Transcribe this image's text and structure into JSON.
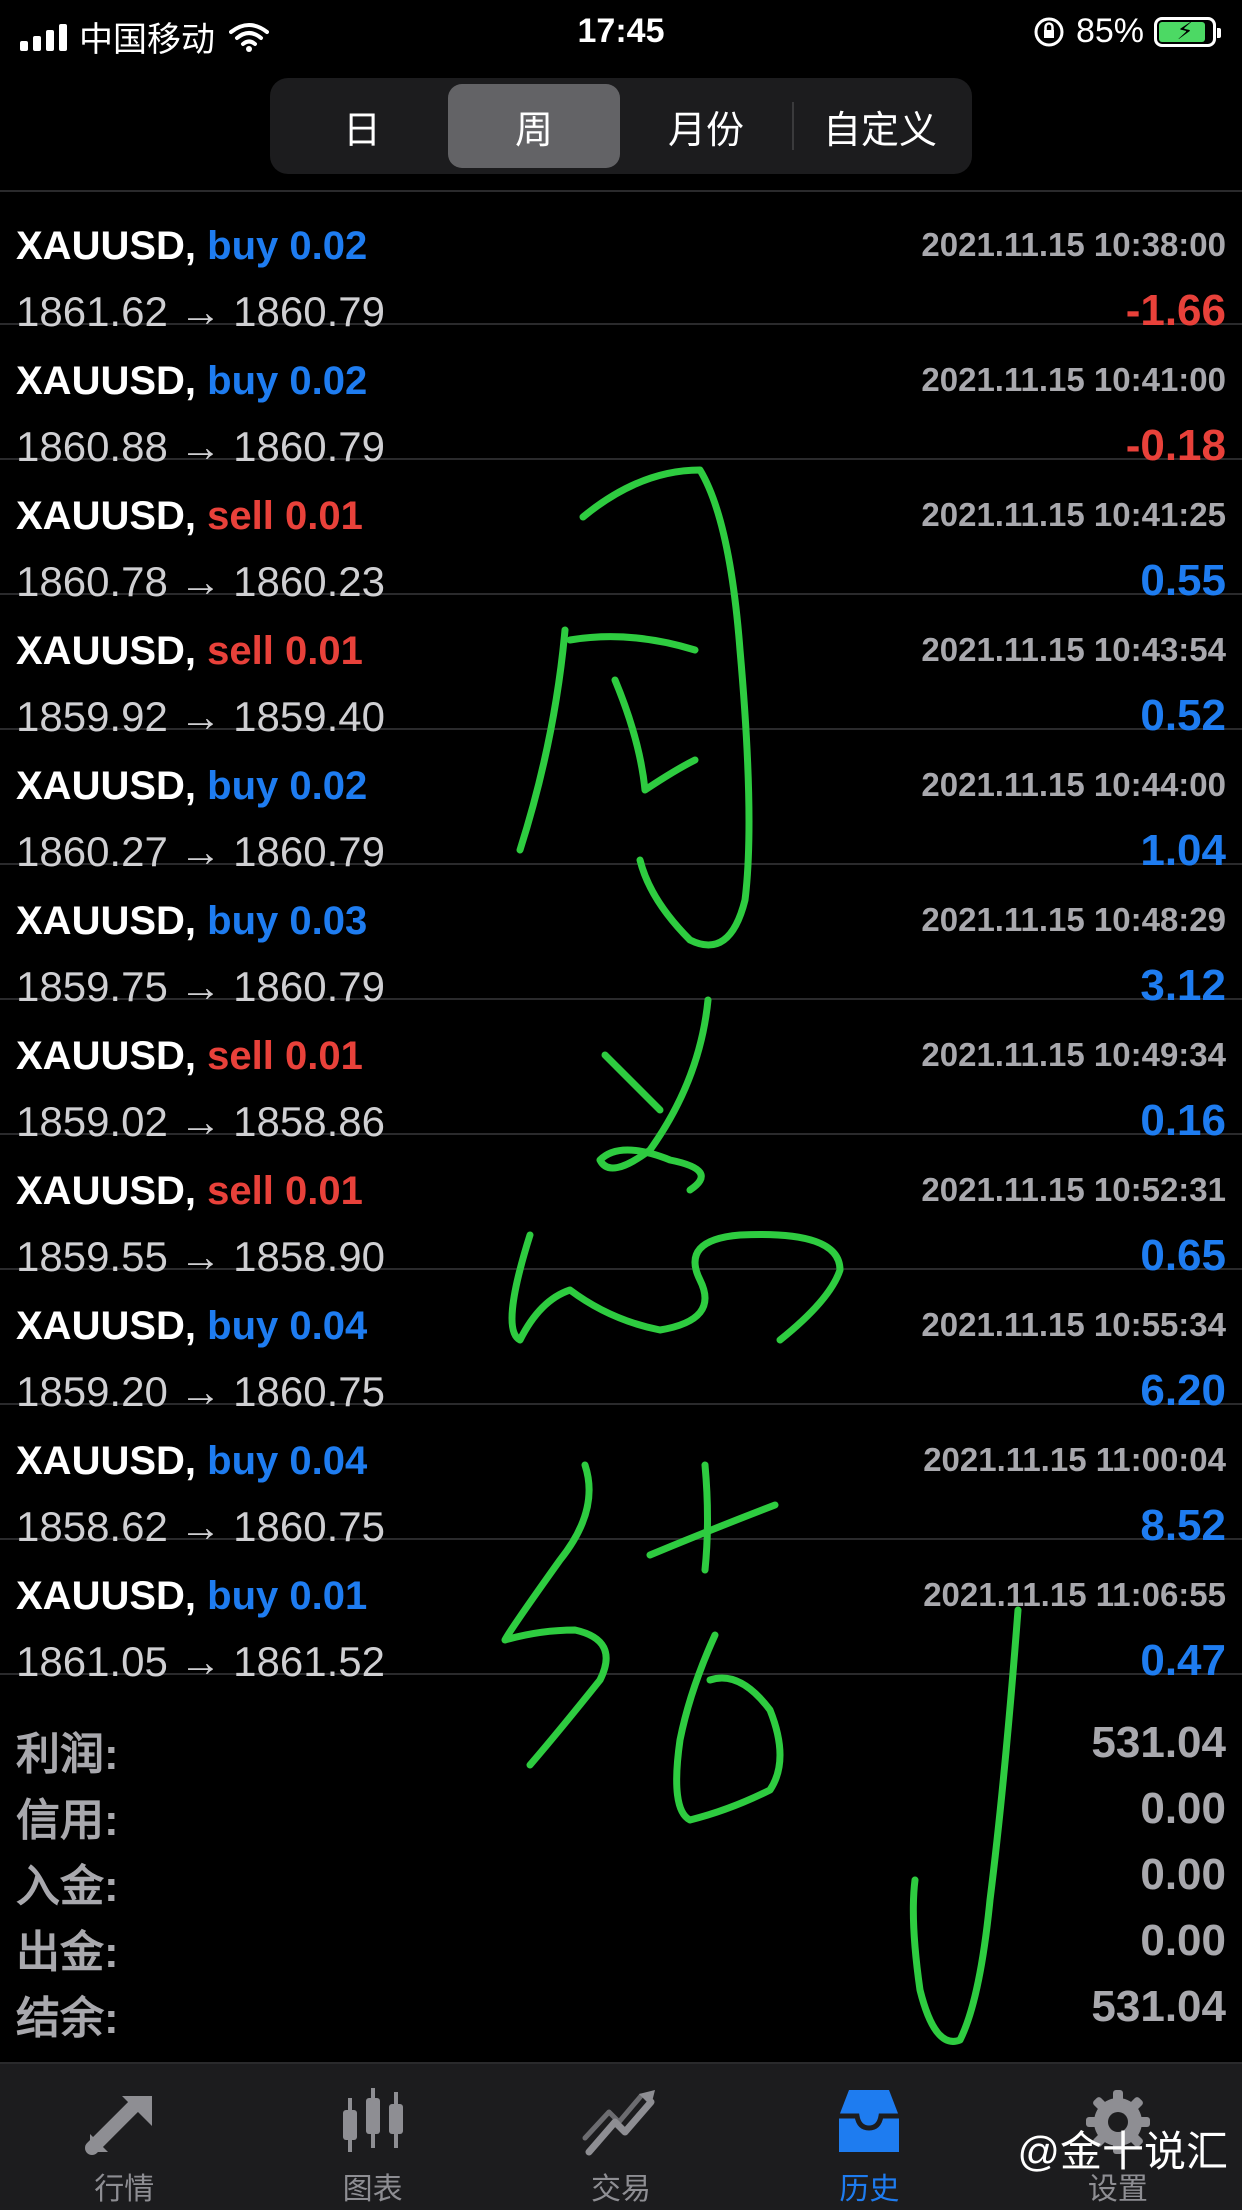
{
  "status_bar": {
    "carrier": "中国移动",
    "time": "17:45",
    "battery": "85%"
  },
  "period_tabs": [
    {
      "label": "日",
      "active": false
    },
    {
      "label": "周",
      "active": true
    },
    {
      "label": "月份",
      "active": false
    },
    {
      "label": "自定义",
      "active": false
    }
  ],
  "trades": [
    {
      "symbol": "XAUUSD,",
      "side": "buy",
      "volume": "buy 0.02",
      "time": "2021.11.15 10:38:00",
      "open": "1861.62",
      "close": "1860.79",
      "profit": "-1.66"
    },
    {
      "symbol": "XAUUSD,",
      "side": "buy",
      "volume": "buy 0.02",
      "time": "2021.11.15 10:41:00",
      "open": "1860.88",
      "close": "1860.79",
      "profit": "-0.18"
    },
    {
      "symbol": "XAUUSD,",
      "side": "sell",
      "volume": "sell 0.01",
      "time": "2021.11.15 10:41:25",
      "open": "1860.78",
      "close": "1860.23",
      "profit": "0.55"
    },
    {
      "symbol": "XAUUSD,",
      "side": "sell",
      "volume": "sell 0.01",
      "time": "2021.11.15 10:43:54",
      "open": "1859.92",
      "close": "1859.40",
      "profit": "0.52"
    },
    {
      "symbol": "XAUUSD,",
      "side": "buy",
      "volume": "buy 0.02",
      "time": "2021.11.15 10:44:00",
      "open": "1860.27",
      "close": "1860.79",
      "profit": "1.04"
    },
    {
      "symbol": "XAUUSD,",
      "side": "buy",
      "volume": "buy 0.03",
      "time": "2021.11.15 10:48:29",
      "open": "1859.75",
      "close": "1860.79",
      "profit": "3.12"
    },
    {
      "symbol": "XAUUSD,",
      "side": "sell",
      "volume": "sell 0.01",
      "time": "2021.11.15 10:49:34",
      "open": "1859.02",
      "close": "1858.86",
      "profit": "0.16"
    },
    {
      "symbol": "XAUUSD,",
      "side": "sell",
      "volume": "sell 0.01",
      "time": "2021.11.15 10:52:31",
      "open": "1859.55",
      "close": "1858.90",
      "profit": "0.65"
    },
    {
      "symbol": "XAUUSD,",
      "side": "buy",
      "volume": "buy 0.04",
      "time": "2021.11.15 10:55:34",
      "open": "1859.20",
      "close": "1860.75",
      "profit": "6.20"
    },
    {
      "symbol": "XAUUSD,",
      "side": "buy",
      "volume": "buy 0.04",
      "time": "2021.11.15 11:00:04",
      "open": "1858.62",
      "close": "1860.75",
      "profit": "8.52"
    },
    {
      "symbol": "XAUUSD,",
      "side": "buy",
      "volume": "buy 0.01",
      "time": "2021.11.15 11:06:55",
      "open": "1861.05",
      "close": "1861.52",
      "profit": "0.47"
    }
  ],
  "arrow": "→",
  "summary": [
    {
      "label": "利润:",
      "value": "531.04"
    },
    {
      "label": "信用:",
      "value": "0.00"
    },
    {
      "label": "入金:",
      "value": "0.00"
    },
    {
      "label": "出金:",
      "value": "0.00"
    },
    {
      "label": "结余:",
      "value": "531.04"
    }
  ],
  "tabbar": [
    {
      "label": "行情",
      "icon": "quotes-icon",
      "active": false
    },
    {
      "label": "图表",
      "icon": "chart-icon",
      "active": false
    },
    {
      "label": "交易",
      "icon": "trade-icon",
      "active": false
    },
    {
      "label": "历史",
      "icon": "history-icon",
      "active": true
    },
    {
      "label": "设置",
      "icon": "settings-icon",
      "active": false
    }
  ],
  "watermark": "@金十说汇",
  "colors": {
    "buy": "#1e7cf0",
    "sell": "#e8413a",
    "handwriting": "#2ecc40",
    "accent": "#1e7cf0"
  }
}
